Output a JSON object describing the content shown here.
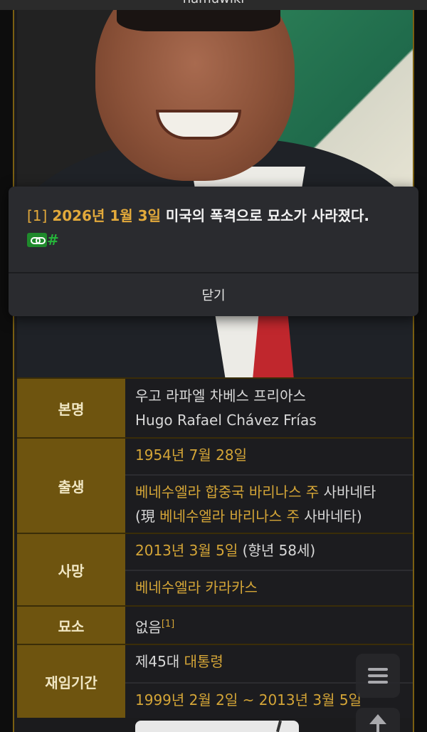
{
  "topbar": {
    "title": "namuwiki"
  },
  "photo": {
    "alt": "portrait"
  },
  "infobox": {
    "rows": [
      {
        "header": "본명",
        "cells": [
          "우고 라파엘 차베스 프리아스",
          "Hugo Rafael Chávez Frías"
        ]
      },
      {
        "header": "출생",
        "cells": [
          "1954년 7월 28일"
        ]
      },
      {
        "header": "사망",
        "cells": [
          "2013년 3월 5일",
          "(향년 58세)",
          "베네수엘라 카라카스"
        ]
      },
      {
        "header": "묘소",
        "cells": [
          "없음",
          "[1]"
        ]
      },
      {
        "header": "재임기간",
        "cells": [
          "제45대",
          "대통령",
          "1999년 2월 2일 ~ 2013년 3월 5일"
        ]
      }
    ],
    "birthplace": {
      "line1_link": "베네수엘라 합중국 바리나스 주",
      "line1_text": " 사바네타",
      "line2_prefix": "(現 ",
      "line2_link": "베네수엘라 바리나스 주",
      "line2_suffix": " 사바네타)"
    }
  },
  "popup": {
    "ref": "[1]",
    "date": "2026년 1월 3일",
    "text": " 미국의 폭격으로 묘소가 사라졌다.",
    "hash": "#",
    "close_label": "닫기"
  },
  "icons": {
    "toc": "list-icon",
    "up": "arrow-up-icon",
    "link": "link-icon"
  }
}
